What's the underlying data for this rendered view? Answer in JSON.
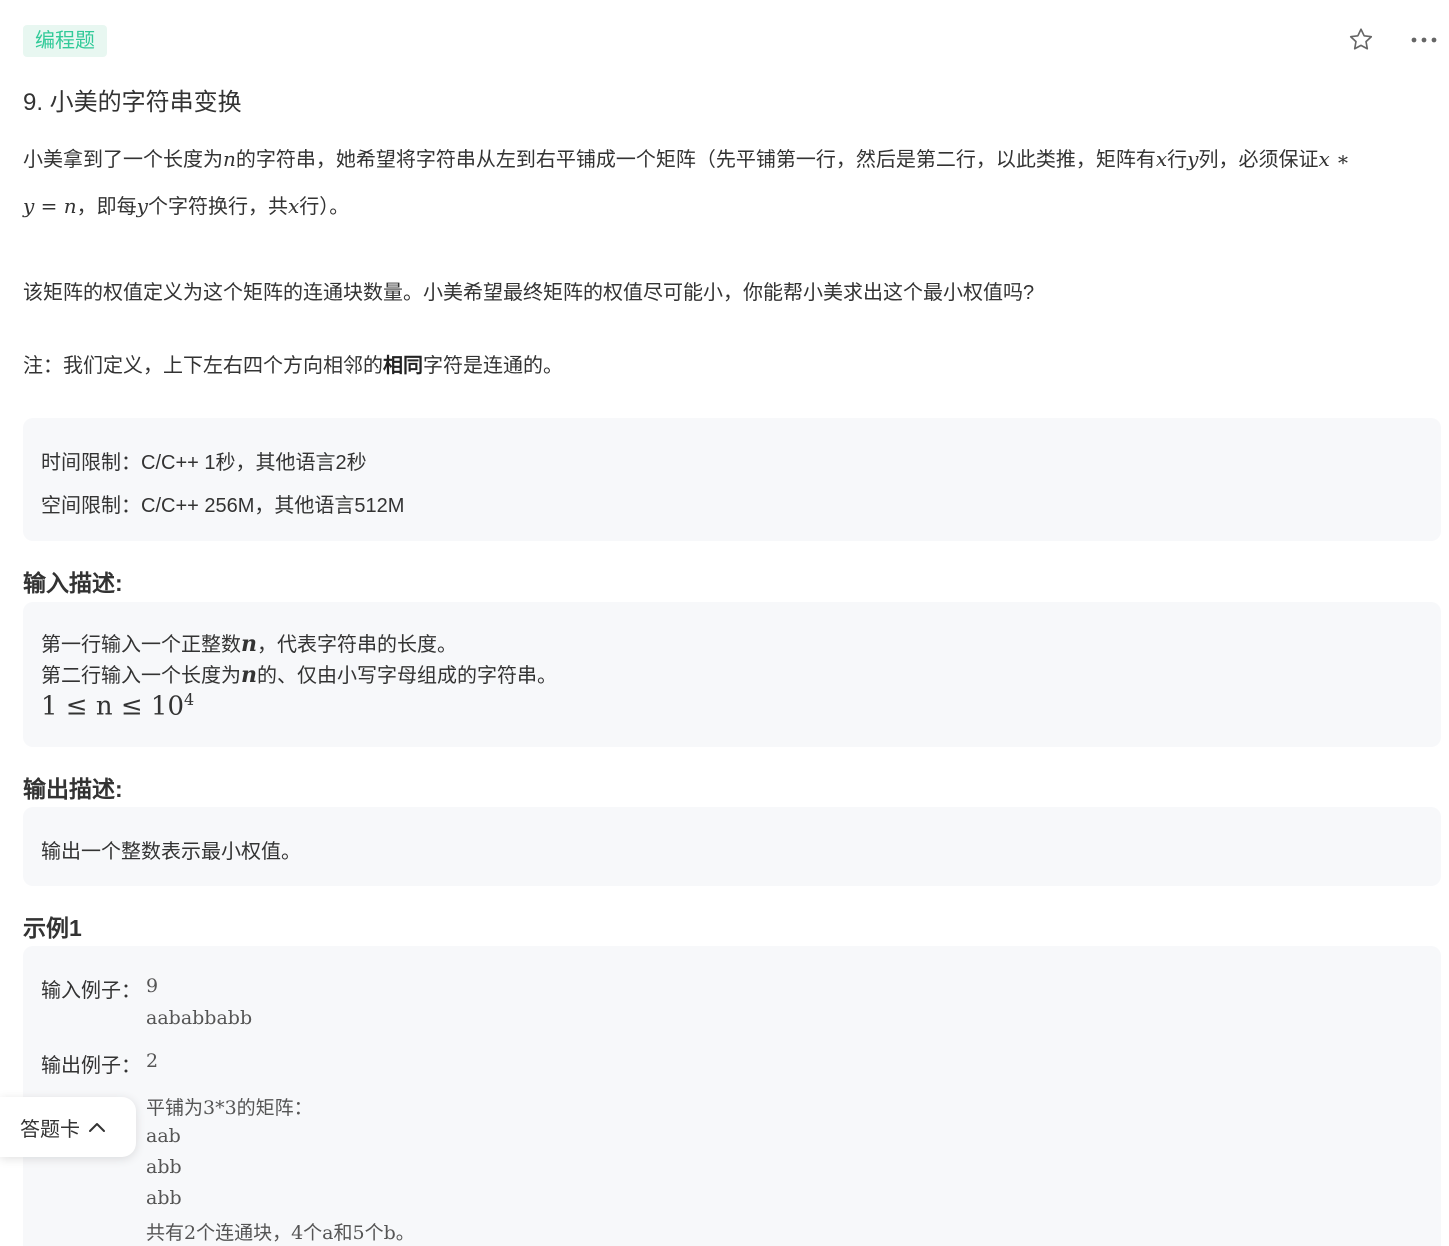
{
  "header": {
    "tag": "编程题",
    "icons": [
      "star-icon",
      "more-icon"
    ]
  },
  "problem": {
    "title": "9. 小美的字符串变换",
    "desc": {
      "p1_a": "小美拿到了一个长度为",
      "p1_n": "n",
      "p1_b": "的字符串，她希望将字符串从左到右平铺成一个矩阵（先平铺第一行，然后是第二行，以此类推，矩阵有",
      "p1_x": "x",
      "p1_c": "行",
      "p1_y": "y",
      "p1_d": "列，必须保证",
      "p1_xs": "x ∗",
      "p2_eq": "y = n",
      "p2_a": "，即每",
      "p2_y": "y",
      "p2_b": "个字符换行，共",
      "p2_x": "x",
      "p2_c": "行）。",
      "p3": "该矩阵的权值定义为这个矩阵的连通块数量。小美希望最终矩阵的权值尽可能小，你能帮小美求出这个最小权值吗?",
      "p4_a": "注：我们定义，上下左右四个方向相邻的",
      "p4_bold": "相同",
      "p4_b": "字符是连通的。"
    },
    "limits": {
      "time": "时间限制：C/C++ 1秒，其他语言2秒",
      "space": "空间限制：C/C++ 256M，其他语言512M"
    },
    "input_heading": "输入描述:",
    "input": {
      "l1_a": "第一行输入一个正整数",
      "l1_n": "n",
      "l1_b": "，代表字符串的长度。",
      "l2_a": "第二行输入一个长度为",
      "l2_n": "n",
      "l2_b": "的、仅由小写字母组成的字符串。",
      "constraint_base": "1 ≤ n ≤ 10",
      "constraint_exp": "4"
    },
    "output_heading": "输出描述:",
    "output": "输出一个整数表示最小权值。",
    "example_heading": "示例1",
    "example": {
      "input_label": "输入例子：",
      "input_lines": [
        "9",
        "aababbabb"
      ],
      "output_label": "输出例子：",
      "output_value": "2",
      "explain_lines": [
        "平铺为3*3的矩阵：",
        "aab",
        "abb",
        "abb",
        "共有2个连通块，4个a和5个b。"
      ]
    }
  },
  "answer_card": {
    "label": "答题卡"
  }
}
